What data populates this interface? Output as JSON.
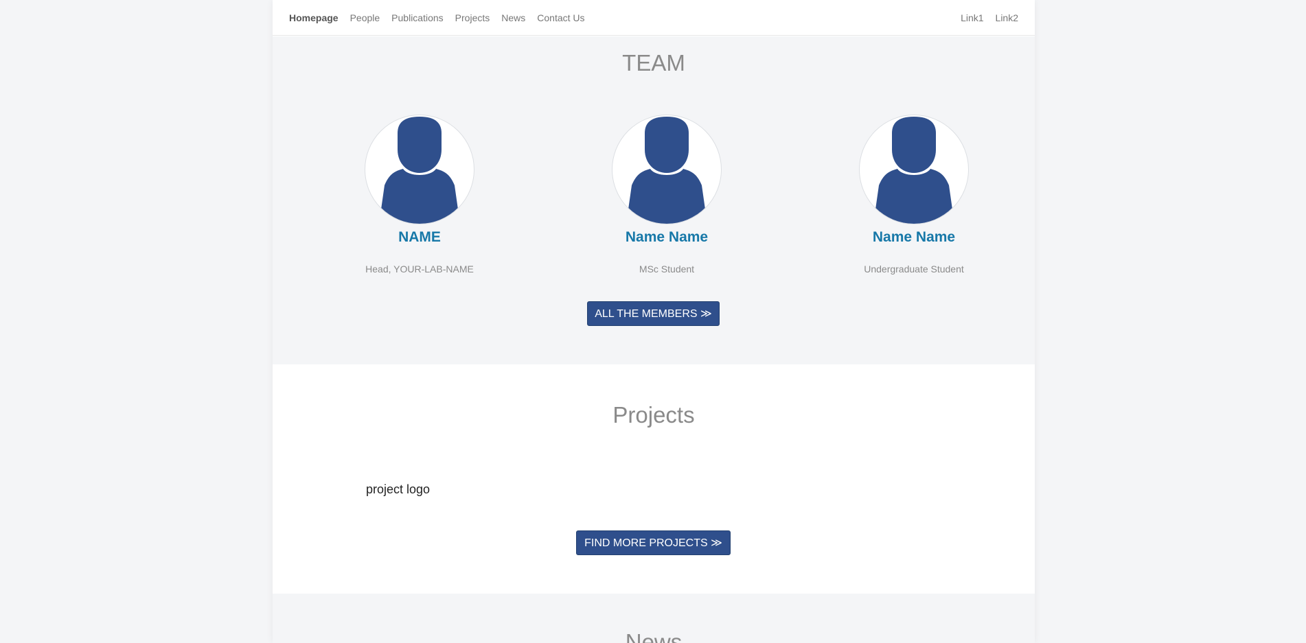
{
  "nav": {
    "left": [
      "Homepage",
      "People",
      "Publications",
      "Projects",
      "News",
      "Contact Us"
    ],
    "right": [
      "Link1",
      "Link2"
    ]
  },
  "team": {
    "title": "TEAM",
    "members": [
      {
        "name": "NAME",
        "role": "Head, YOUR-LAB-NAME"
      },
      {
        "name": "Name Name",
        "role": "MSc Student"
      },
      {
        "name": "Name Name",
        "role": "Undergraduate Student"
      }
    ],
    "button": "ALL THE MEMBERS ≫"
  },
  "projects": {
    "title": "Projects",
    "logo_alt": "project logo",
    "button": "FIND MORE PROJECTS ≫"
  },
  "news": {
    "title": "News"
  },
  "colors": {
    "accent": "#2f4f8c",
    "name": "#1778a8",
    "avatar": "#2f4f8c"
  }
}
